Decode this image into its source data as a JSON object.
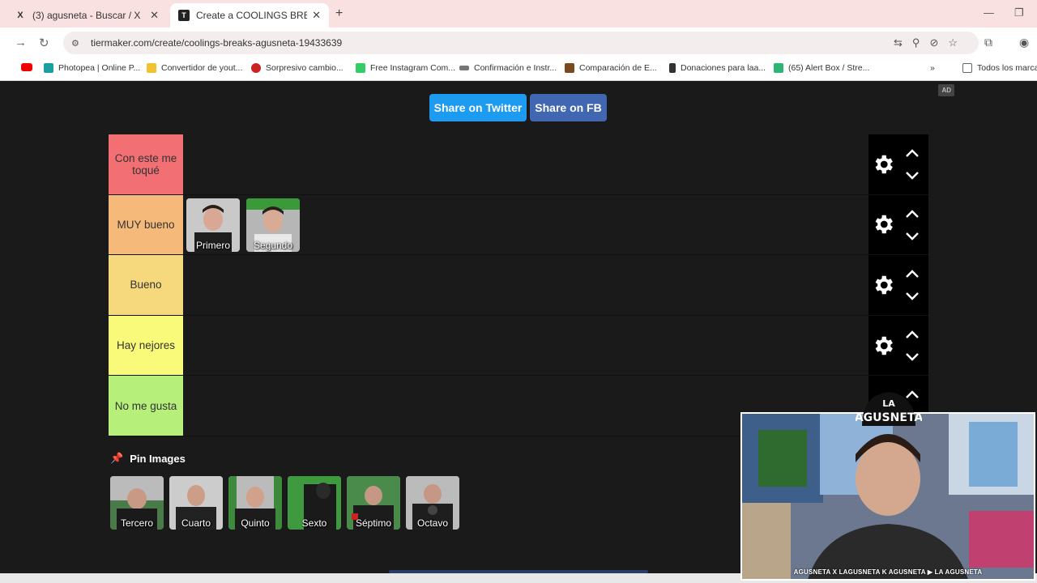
{
  "browser": {
    "tabs": [
      {
        "title": "(3) agusneta - Buscar / X",
        "favicon": "X"
      },
      {
        "title": "Create a COOLINGS BREAKS AGUSNETA",
        "favicon": "T"
      }
    ],
    "url": "tiermaker.com/create/coolings-breaks-agusneta-19433639",
    "bookmarks": [
      "Photopea | Online P...",
      "Convertidor de yout...",
      "Sorpresivo cambio...",
      "Free Instagram Com...",
      "Confirmación e Instr...",
      "Comparación de E...",
      "Donaciones para laa...",
      "(65) Alert Box / Stre...",
      "Todos los marca"
    ]
  },
  "page": {
    "ad": "AD",
    "share_twitter": "Share on Twitter",
    "share_fb": "Share on FB",
    "tiers": [
      {
        "label": "Con este me toqué",
        "color": "#f26f73",
        "items": []
      },
      {
        "label": "MUY bueno",
        "color": "#f5b97a",
        "items": [
          {
            "caption": "Primero"
          },
          {
            "caption": "Segundo"
          }
        ]
      },
      {
        "label": "Bueno",
        "color": "#f6d97c",
        "items": []
      },
      {
        "label": "Hay nejores",
        "color": "#fafa7a",
        "items": []
      },
      {
        "label": "No me gusta",
        "color": "#b6f07a",
        "items": []
      }
    ],
    "pin_images_label": "Pin Images",
    "pool": [
      {
        "caption": "Tercero"
      },
      {
        "caption": "Cuarto"
      },
      {
        "caption": "Quinto"
      },
      {
        "caption": "Sexto"
      },
      {
        "caption": "Séptimo"
      },
      {
        "caption": "Octavo"
      }
    ]
  },
  "webcam": {
    "logo_text": "LA AGUSNETA",
    "caption": "AGUSNETA  X LAGUSNETA  K AGUSNETA  ▶ LA AGUSNETA"
  }
}
